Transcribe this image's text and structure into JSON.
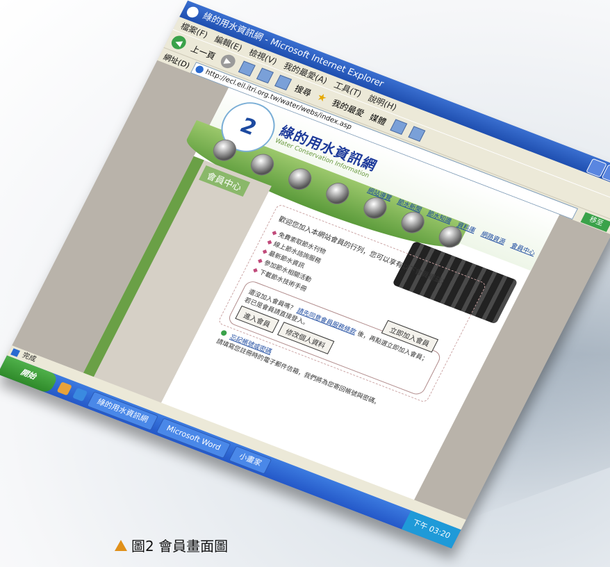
{
  "window": {
    "title": "綠的用水資訊網 - Microsoft Internet Explorer"
  },
  "menu": [
    "檔案(F)",
    "編輯(E)",
    "檢視(V)",
    "我的最愛(A)",
    "工具(T)",
    "說明(H)"
  ],
  "toolbar": {
    "back_label": "上一頁",
    "search_label": "搜尋",
    "favorites_label": "我的最愛",
    "media_label": "媒體"
  },
  "address": {
    "label": "網址(D)",
    "url": "http://ecl.eil.itri.org.tw/water/webs/index.asp",
    "go_label": "移至"
  },
  "site": {
    "logo_number": "2",
    "name": "綠的用水資訊網",
    "subtitle": "Water Conservation Information",
    "nav": [
      "網站導覽",
      "節水新聞",
      "節水知識",
      "資料庫",
      "網路資源",
      "會員中心"
    ]
  },
  "sidebar": {
    "title": "會員中心"
  },
  "member": {
    "intro": "歡迎您加入本網站會員的行列，您可以享有以下會員權益：",
    "benefits": [
      "免費索取節水刊物",
      "線上節水諮詢服務",
      "最新節水資訊",
      "參加節水相關活動",
      "下載節水技術手冊"
    ],
    "login_prompt": "還沒加入會員嗎？",
    "login_link": "請先同意會員服務條款",
    "login_note": "後，再點選立即加入會員；若已是會員請直接登入。",
    "register_button": "立即加入會員",
    "login_button": "進入會員",
    "modify_button": "修改個人資料",
    "forgot_link": "忘記帳號或密碼",
    "forgot_note": "請填寫您註冊時的電子郵件信箱，我們將為您寄回帳號與密碼。"
  },
  "statusbar": {
    "text": "完成"
  },
  "taskbar": {
    "start_label": "開始",
    "items": [
      "綠的用水資訊網",
      "Microsoft Word",
      "小畫家"
    ],
    "clock": "下午 03:20"
  },
  "caption": {
    "text": "圖2 會員畫面圖"
  },
  "colors": {
    "titlebar": "#2458c8",
    "brand_green": "#6aa046",
    "brand_blue": "#1d3a9a",
    "caption_triangle": "#e0901a"
  },
  "icons": {
    "browser": "ie-icon",
    "back": "back-arrow-icon",
    "favorites": "star-icon",
    "caption": "triangle-icon"
  }
}
